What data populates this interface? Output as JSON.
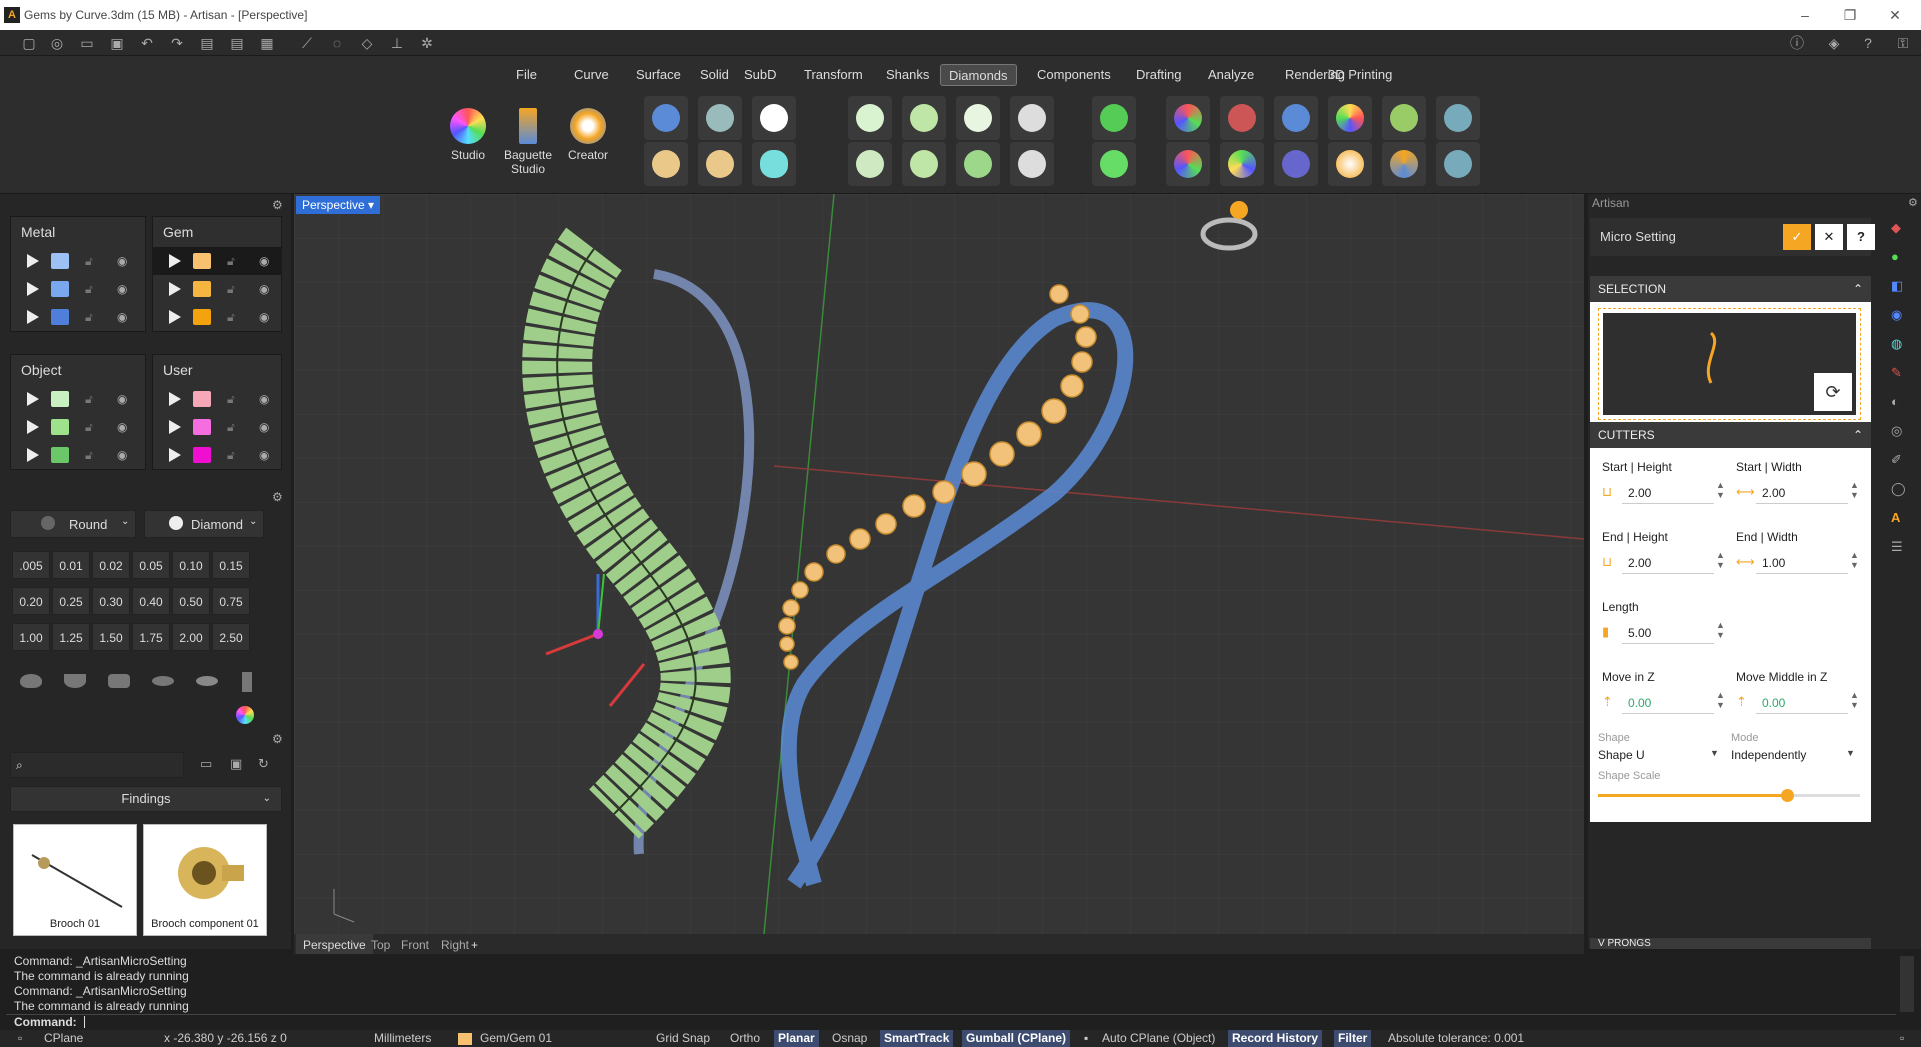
{
  "window": {
    "title": "Gems by Curve.3dm (15 MB) - Artisan - [Perspective]",
    "minimize": "–",
    "restore": "❐",
    "close": "✕"
  },
  "menu": {
    "items": [
      "File",
      "Curve",
      "Surface",
      "Solid",
      "SubD",
      "Transform",
      "Shanks",
      "Diamonds",
      "Components",
      "Drafting",
      "Analyze",
      "Rendering",
      "3D Printing"
    ]
  },
  "ribbon": {
    "tools": [
      "Studio",
      "Baguette Studio",
      "Creator"
    ]
  },
  "layers": {
    "metal": "Metal",
    "gem": "Gem",
    "object": "Object",
    "user": "User"
  },
  "gems": {
    "cut": "Round",
    "material": "Diamond",
    "sizes": [
      ".005",
      "0.01",
      "0.02",
      "0.05",
      "0.10",
      "0.15",
      "0.20",
      "0.25",
      "0.30",
      "0.40",
      "0.50",
      "0.75",
      "1.00",
      "1.25",
      "1.50",
      "1.75",
      "2.00",
      "2.50"
    ]
  },
  "library": {
    "search_placeholder": "",
    "category": "Findings",
    "items": [
      "Brooch 01",
      "Brooch component 01"
    ]
  },
  "viewport": {
    "name": "Perspective",
    "tabs": [
      "Perspective",
      "Top",
      "Front",
      "Right",
      "+"
    ]
  },
  "artisan": {
    "panel_title": "Artisan",
    "command": "Micro Setting",
    "ok": "✓",
    "cancel": "✕",
    "help": "?",
    "selection_label": "SELECTION",
    "cutters_label": "CUTTERS",
    "prongs_label": "V PRONGS",
    "start_height_label": "Start | Height",
    "start_height": "2.00",
    "start_width_label": "Start | Width",
    "start_width": "2.00",
    "end_height_label": "End | Height",
    "end_height": "2.00",
    "end_width_label": "End | Width",
    "end_width": "1.00",
    "length_label": "Length",
    "length": "5.00",
    "move_z_label": "Move in Z",
    "move_z": "0.00",
    "move_mid_label": "Move Middle in Z",
    "move_mid": "0.00",
    "shape_label": "Shape",
    "shape": "Shape U",
    "mode_label": "Mode",
    "mode": "Independently",
    "scale_label": "Shape Scale",
    "scale_value": 0.72
  },
  "command": {
    "history": [
      "Command: _ArtisanMicroSetting",
      "The command is already running",
      "Command: _ArtisanMicroSetting",
      "The command is already running"
    ],
    "prompt": "Command:"
  },
  "status": {
    "cplane": "CPlane",
    "coords": "x -26.380  y -26.156  z 0",
    "units": "Millimeters",
    "layer": "Gem/Gem 01",
    "grid_snap": "Grid Snap",
    "ortho": "Ortho",
    "planar": "Planar",
    "osnap": "Osnap",
    "smarttrack": "SmartTrack",
    "gumball": "Gumball (CPlane)",
    "autocplane": "Auto CPlane (Object)",
    "record": "Record History",
    "filter": "Filter",
    "tolerance": "Absolute tolerance: 0.001"
  },
  "colors": {
    "accent": "#f5a623",
    "gem": "#f2c27a",
    "metal": "#5b8bd6",
    "green": "#b9e3a8"
  }
}
